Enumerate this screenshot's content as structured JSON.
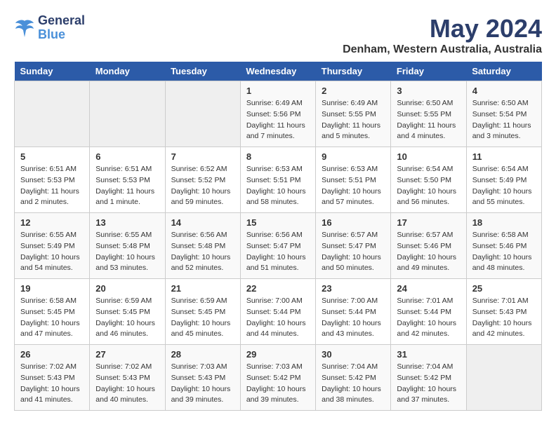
{
  "logo": {
    "line1": "General",
    "line2": "Blue"
  },
  "title": "May 2024",
  "subtitle": "Denham, Western Australia, Australia",
  "days_of_week": [
    "Sunday",
    "Monday",
    "Tuesday",
    "Wednesday",
    "Thursday",
    "Friday",
    "Saturday"
  ],
  "weeks": [
    [
      {
        "day": "",
        "info": ""
      },
      {
        "day": "",
        "info": ""
      },
      {
        "day": "",
        "info": ""
      },
      {
        "day": "1",
        "info": "Sunrise: 6:49 AM\nSunset: 5:56 PM\nDaylight: 11 hours\nand 7 minutes."
      },
      {
        "day": "2",
        "info": "Sunrise: 6:49 AM\nSunset: 5:55 PM\nDaylight: 11 hours\nand 5 minutes."
      },
      {
        "day": "3",
        "info": "Sunrise: 6:50 AM\nSunset: 5:55 PM\nDaylight: 11 hours\nand 4 minutes."
      },
      {
        "day": "4",
        "info": "Sunrise: 6:50 AM\nSunset: 5:54 PM\nDaylight: 11 hours\nand 3 minutes."
      }
    ],
    [
      {
        "day": "5",
        "info": "Sunrise: 6:51 AM\nSunset: 5:53 PM\nDaylight: 11 hours\nand 2 minutes."
      },
      {
        "day": "6",
        "info": "Sunrise: 6:51 AM\nSunset: 5:53 PM\nDaylight: 11 hours\nand 1 minute."
      },
      {
        "day": "7",
        "info": "Sunrise: 6:52 AM\nSunset: 5:52 PM\nDaylight: 10 hours\nand 59 minutes."
      },
      {
        "day": "8",
        "info": "Sunrise: 6:53 AM\nSunset: 5:51 PM\nDaylight: 10 hours\nand 58 minutes."
      },
      {
        "day": "9",
        "info": "Sunrise: 6:53 AM\nSunset: 5:51 PM\nDaylight: 10 hours\nand 57 minutes."
      },
      {
        "day": "10",
        "info": "Sunrise: 6:54 AM\nSunset: 5:50 PM\nDaylight: 10 hours\nand 56 minutes."
      },
      {
        "day": "11",
        "info": "Sunrise: 6:54 AM\nSunset: 5:49 PM\nDaylight: 10 hours\nand 55 minutes."
      }
    ],
    [
      {
        "day": "12",
        "info": "Sunrise: 6:55 AM\nSunset: 5:49 PM\nDaylight: 10 hours\nand 54 minutes."
      },
      {
        "day": "13",
        "info": "Sunrise: 6:55 AM\nSunset: 5:48 PM\nDaylight: 10 hours\nand 53 minutes."
      },
      {
        "day": "14",
        "info": "Sunrise: 6:56 AM\nSunset: 5:48 PM\nDaylight: 10 hours\nand 52 minutes."
      },
      {
        "day": "15",
        "info": "Sunrise: 6:56 AM\nSunset: 5:47 PM\nDaylight: 10 hours\nand 51 minutes."
      },
      {
        "day": "16",
        "info": "Sunrise: 6:57 AM\nSunset: 5:47 PM\nDaylight: 10 hours\nand 50 minutes."
      },
      {
        "day": "17",
        "info": "Sunrise: 6:57 AM\nSunset: 5:46 PM\nDaylight: 10 hours\nand 49 minutes."
      },
      {
        "day": "18",
        "info": "Sunrise: 6:58 AM\nSunset: 5:46 PM\nDaylight: 10 hours\nand 48 minutes."
      }
    ],
    [
      {
        "day": "19",
        "info": "Sunrise: 6:58 AM\nSunset: 5:45 PM\nDaylight: 10 hours\nand 47 minutes."
      },
      {
        "day": "20",
        "info": "Sunrise: 6:59 AM\nSunset: 5:45 PM\nDaylight: 10 hours\nand 46 minutes."
      },
      {
        "day": "21",
        "info": "Sunrise: 6:59 AM\nSunset: 5:45 PM\nDaylight: 10 hours\nand 45 minutes."
      },
      {
        "day": "22",
        "info": "Sunrise: 7:00 AM\nSunset: 5:44 PM\nDaylight: 10 hours\nand 44 minutes."
      },
      {
        "day": "23",
        "info": "Sunrise: 7:00 AM\nSunset: 5:44 PM\nDaylight: 10 hours\nand 43 minutes."
      },
      {
        "day": "24",
        "info": "Sunrise: 7:01 AM\nSunset: 5:44 PM\nDaylight: 10 hours\nand 42 minutes."
      },
      {
        "day": "25",
        "info": "Sunrise: 7:01 AM\nSunset: 5:43 PM\nDaylight: 10 hours\nand 42 minutes."
      }
    ],
    [
      {
        "day": "26",
        "info": "Sunrise: 7:02 AM\nSunset: 5:43 PM\nDaylight: 10 hours\nand 41 minutes."
      },
      {
        "day": "27",
        "info": "Sunrise: 7:02 AM\nSunset: 5:43 PM\nDaylight: 10 hours\nand 40 minutes."
      },
      {
        "day": "28",
        "info": "Sunrise: 7:03 AM\nSunset: 5:43 PM\nDaylight: 10 hours\nand 39 minutes."
      },
      {
        "day": "29",
        "info": "Sunrise: 7:03 AM\nSunset: 5:42 PM\nDaylight: 10 hours\nand 39 minutes."
      },
      {
        "day": "30",
        "info": "Sunrise: 7:04 AM\nSunset: 5:42 PM\nDaylight: 10 hours\nand 38 minutes."
      },
      {
        "day": "31",
        "info": "Sunrise: 7:04 AM\nSunset: 5:42 PM\nDaylight: 10 hours\nand 37 minutes."
      },
      {
        "day": "",
        "info": ""
      }
    ]
  ]
}
